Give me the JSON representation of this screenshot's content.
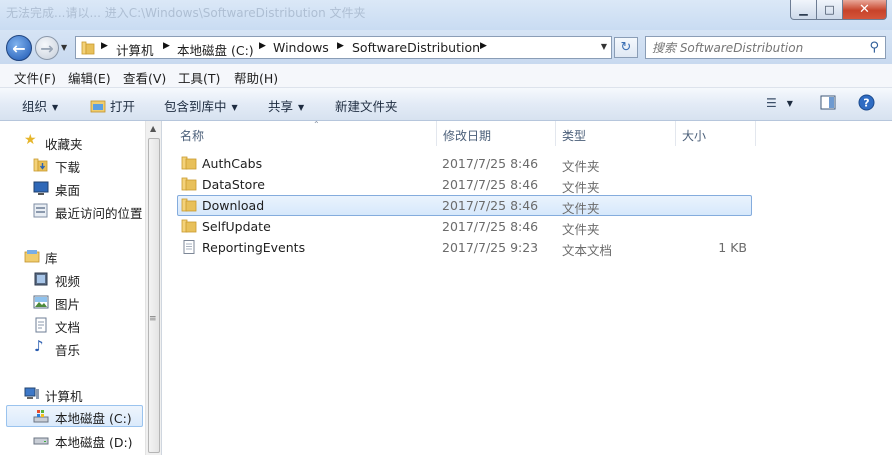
{
  "window": {
    "title": "无法完成...请以... 进入C:\\Windows\\SoftwareDistribution 文件夹",
    "minimize": "▁",
    "maximize": "□",
    "close": "✕"
  },
  "address": {
    "segments": [
      "计算机",
      "本地磁盘 (C:)",
      "Windows",
      "SoftwareDistribution"
    ],
    "search_placeholder": "搜索 SoftwareDistribution"
  },
  "menu": [
    "文件(F)",
    "编辑(E)",
    "查看(V)",
    "工具(T)",
    "帮助(H)"
  ],
  "toolbar": {
    "organize": "组织",
    "open": "打开",
    "include_library": "包含到库中",
    "share": "共享",
    "new_folder": "新建文件夹"
  },
  "nav": {
    "favorites": "收藏夹",
    "downloads": "下载",
    "desktop": "桌面",
    "recent": "最近访问的位置",
    "libraries": "库",
    "videos": "视频",
    "pictures": "图片",
    "documents": "文档",
    "music": "音乐",
    "computer": "计算机",
    "disk_c": "本地磁盘 (C:)",
    "disk_d": "本地磁盘 (D:)"
  },
  "columns": {
    "name": "名称",
    "date": "修改日期",
    "type": "类型",
    "size": "大小"
  },
  "files": [
    {
      "name": "AuthCabs",
      "date": "2017/7/25 8:46",
      "type": "文件夹",
      "size": ""
    },
    {
      "name": "DataStore",
      "date": "2017/7/25 8:46",
      "type": "文件夹",
      "size": ""
    },
    {
      "name": "Download",
      "date": "2017/7/25 8:46",
      "type": "文件夹",
      "size": ""
    },
    {
      "name": "SelfUpdate",
      "date": "2017/7/25 8:46",
      "type": "文件夹",
      "size": ""
    },
    {
      "name": "ReportingEvents",
      "date": "2017/7/25 9:23",
      "type": "文本文档",
      "size": "1 KB"
    }
  ],
  "colors": {
    "selection": "#d6e8fb",
    "folder": "#e8c05a"
  }
}
